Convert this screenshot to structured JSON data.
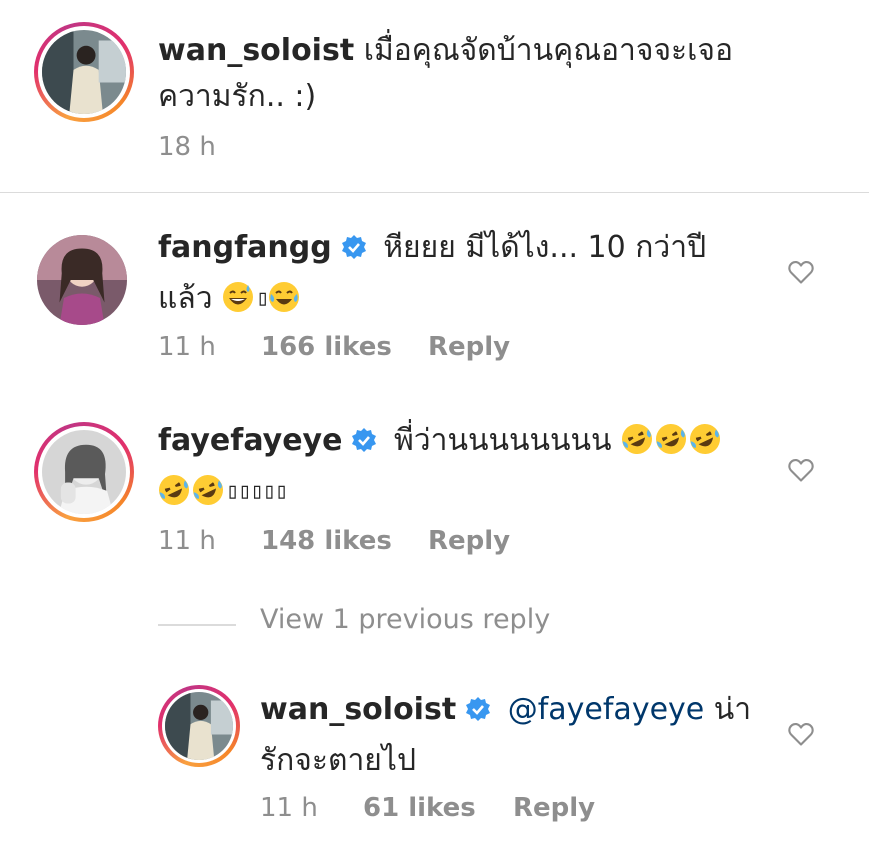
{
  "caption": {
    "username": "wan_soloist",
    "text_line1": "เมื่อคุณจัดบ้านคุณอาจจะเจอ",
    "text_line2": "ความรัก.. :)",
    "time": "18 h"
  },
  "comments": [
    {
      "username": "fangfangg",
      "verified": true,
      "text_line1": "หียยย มีได้ไง... 10 กว่าปี",
      "text_line2": "แล้ว",
      "emoji_line2": [
        "grinning-sweat-emoji",
        "missing-glyph-box",
        "tears-of-joy-emoji"
      ],
      "time": "11 h",
      "likes": "166 likes",
      "reply": "Reply"
    },
    {
      "username": "fayefayeye",
      "verified": true,
      "text_line1": "พี่ว่านนนนนนนน",
      "emoji_line1": [
        "rofl-emoji",
        "rofl-emoji",
        "rofl-emoji"
      ],
      "emoji_line2": [
        "rofl-emoji",
        "rofl-emoji"
      ],
      "boxes": "▯▯▯▯▯",
      "time": "11 h",
      "likes": "148 likes",
      "reply": "Reply"
    }
  ],
  "view_replies": "View 1 previous reply",
  "reply": {
    "username": "wan_soloist",
    "verified": true,
    "mention": "@fayefayeye",
    "text_line1_rest": "น่า",
    "text_line2": "รักจะตายไป",
    "time": "11 h",
    "likes": "61 likes",
    "reply": "Reply"
  },
  "colors": {
    "verified_blue": "#3897f0",
    "meta_grey": "#8e8e8e",
    "mention": "#00376b"
  }
}
